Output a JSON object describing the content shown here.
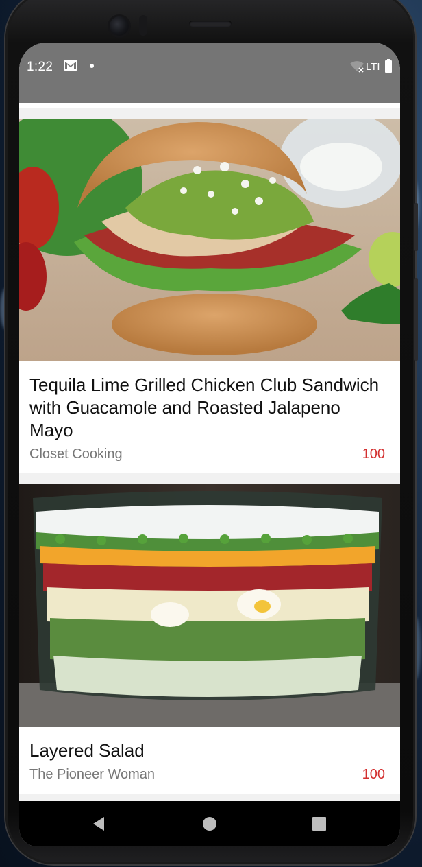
{
  "status_bar": {
    "time": "1:22",
    "network": "LTI",
    "icons": [
      "gmail-icon",
      "notification-dot",
      "wifi-off-icon",
      "battery-icon"
    ]
  },
  "recipes": [
    {
      "title": "Tequila Lime Grilled Chicken Club Sandwich with Guacamole and Roasted Jalapeno Mayo",
      "source": "Closet Cooking",
      "score": "100",
      "image": "chicken-club-sandwich-photo"
    },
    {
      "title": "Layered Salad",
      "source": "The Pioneer Woman",
      "score": "100",
      "image": "layered-salad-photo"
    }
  ],
  "navigation": {
    "buttons": [
      "back-button",
      "home-button",
      "recents-button"
    ]
  },
  "colors": {
    "status_bar": "#757575",
    "score": "#d32f2f",
    "background": "#f1f1f1"
  }
}
